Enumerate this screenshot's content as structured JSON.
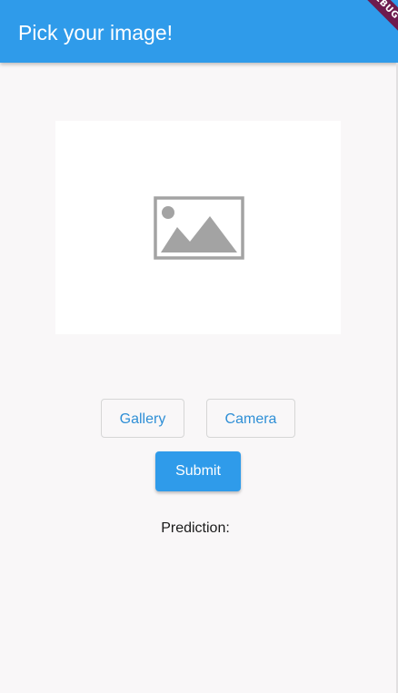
{
  "appbar": {
    "title": "Pick your image!",
    "debug_banner": "DEBUG",
    "color": "#2f9bea"
  },
  "image_placeholder": {
    "icon": "image-placeholder-icon"
  },
  "buttons": {
    "gallery_label": "Gallery",
    "camera_label": "Camera",
    "submit_label": "Submit"
  },
  "prediction": {
    "label": "Prediction:"
  }
}
